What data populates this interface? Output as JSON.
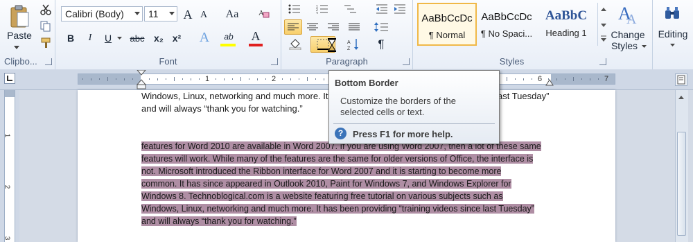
{
  "clipboard": {
    "paste_label": "Paste",
    "group_label": "Clipbo..."
  },
  "font": {
    "name": "Calibri (Body)",
    "size": "11",
    "group_label": "Font",
    "grow_label": "A",
    "shrink_label": "A",
    "case_label": "Aa",
    "bold": "B",
    "italic": "I",
    "underline": "U",
    "strike": "abc",
    "subscript": "x₂",
    "superscript": "x²",
    "effects_label": "A",
    "highlight_label": "ab",
    "color_label": "A",
    "highlight_color": "#ffff00",
    "font_color": "#e02020"
  },
  "paragraph": {
    "group_label": "Paragraph",
    "pilcrow": "¶"
  },
  "styles": {
    "items": [
      {
        "sample": "AaBbCcDc",
        "name": "¶ Normal"
      },
      {
        "sample": "AaBbCcDc",
        "name": "¶ No Spaci..."
      },
      {
        "sample": "AaBbC",
        "name": "Heading 1"
      }
    ],
    "change_label_1": "Change",
    "change_label_2": "Styles",
    "group_label": "Styles"
  },
  "editing": {
    "label": "Editing"
  },
  "ruler": {
    "numbers": [
      "1",
      "2",
      "3",
      "4",
      "5",
      "6",
      "7"
    ]
  },
  "vruler": {
    "numbers": [
      "1",
      "2",
      "3"
    ]
  },
  "document": {
    "top_lines": [
      "Windows, Linux, networking and much more.  It",
      "and will always “thank you for watching.”"
    ],
    "top_right_fragment": "ast Tuesday”",
    "selected_lines": [
      "features for Word 2010 are available in Word 2007.  If you are using Word 2007, then a lot of these same",
      "features will work. While many of the features are the same for older versions of Office, the interface is",
      "not.  Microsoft introduced the Ribbon interface for Word 2007 and it is starting to become more",
      "common. It has since appeared in Outlook 2010, Paint for Windows 7, and Windows Explorer for",
      "Windows 8. Technoblogical.com is a website featuring free tutorial on various subjects such as",
      "Windows, Linux, networking and much more.  It has been providing “training videos since last Tuesday”",
      "and will always “thank you for watching.”"
    ]
  },
  "tooltip": {
    "title": "Bottom Border",
    "description": "Customize the borders of the selected cells or text.",
    "help": "Press F1 for more help.",
    "help_icon": "?"
  }
}
